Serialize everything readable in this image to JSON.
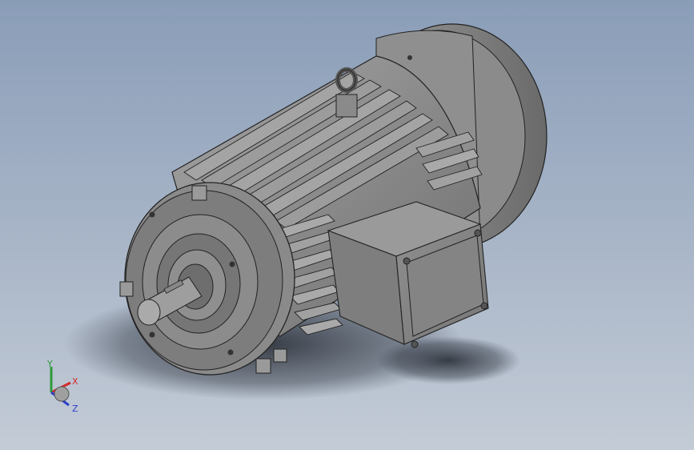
{
  "viewport": {
    "background_top": "#8a9db8",
    "background_bottom": "#c3cbd6"
  },
  "model": {
    "body_color": "#8c8c8c",
    "fin_color": "#9a9a9a",
    "shadow_color": "#2a2f38"
  },
  "triad": {
    "x_label": "X",
    "y_label": "Y",
    "z_label": "Z",
    "x_color": "#d42a2a",
    "y_color": "#2e9a3a",
    "z_color": "#2a3fc8"
  }
}
